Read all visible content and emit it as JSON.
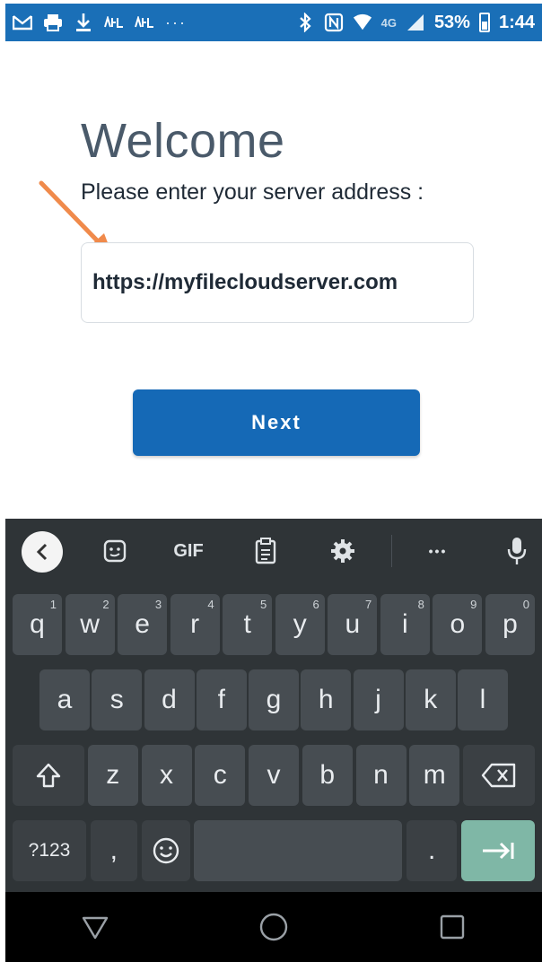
{
  "status_bar": {
    "icons": [
      "gmail-icon",
      "printer-icon",
      "download-icon",
      "nfl-icon",
      "nfl-icon-2",
      "more-dots-icon",
      "bluetooth-icon",
      "nfc-icon",
      "wifi-icon",
      "signal-icon",
      "battery-icon"
    ],
    "dots": "···",
    "network": "4G",
    "battery": "53%",
    "time": "1:44"
  },
  "welcome": {
    "title": "Welcome",
    "prompt": "Please enter your server address :"
  },
  "server_input": {
    "value": "https://myfilecloudserver.com",
    "placeholder": ""
  },
  "next_button": {
    "label": "Next"
  },
  "keyboard": {
    "toolbar": {
      "gif_label": "GIF",
      "icons": [
        "back-chevron-icon",
        "sticker-icon",
        "gif-icon",
        "clipboard-icon",
        "settings-gear-icon",
        "more-dots-icon",
        "microphone-icon"
      ],
      "more": "•••"
    },
    "row1": [
      {
        "k": "q",
        "n": "1"
      },
      {
        "k": "w",
        "n": "2"
      },
      {
        "k": "e",
        "n": "3"
      },
      {
        "k": "r",
        "n": "4"
      },
      {
        "k": "t",
        "n": "5"
      },
      {
        "k": "y",
        "n": "6"
      },
      {
        "k": "u",
        "n": "7"
      },
      {
        "k": "i",
        "n": "8"
      },
      {
        "k": "o",
        "n": "9"
      },
      {
        "k": "p",
        "n": "0"
      }
    ],
    "row2": [
      "a",
      "s",
      "d",
      "f",
      "g",
      "h",
      "j",
      "k",
      "l"
    ],
    "row3": [
      "z",
      "x",
      "c",
      "v",
      "b",
      "n",
      "m"
    ],
    "row4": {
      "symbols_label": "?123",
      "comma": ",",
      "period": "."
    }
  },
  "nav_bar": {
    "icons": [
      "back-triangle-icon",
      "home-circle-icon",
      "recents-square-icon"
    ]
  },
  "colors": {
    "status_bar": "#1a6fb7",
    "next_button": "#1569b6",
    "keyboard_bg": "#2f3437",
    "key_bg": "#474d52",
    "enter_key": "#7fb7a6",
    "arrow": "#f08a4b"
  }
}
